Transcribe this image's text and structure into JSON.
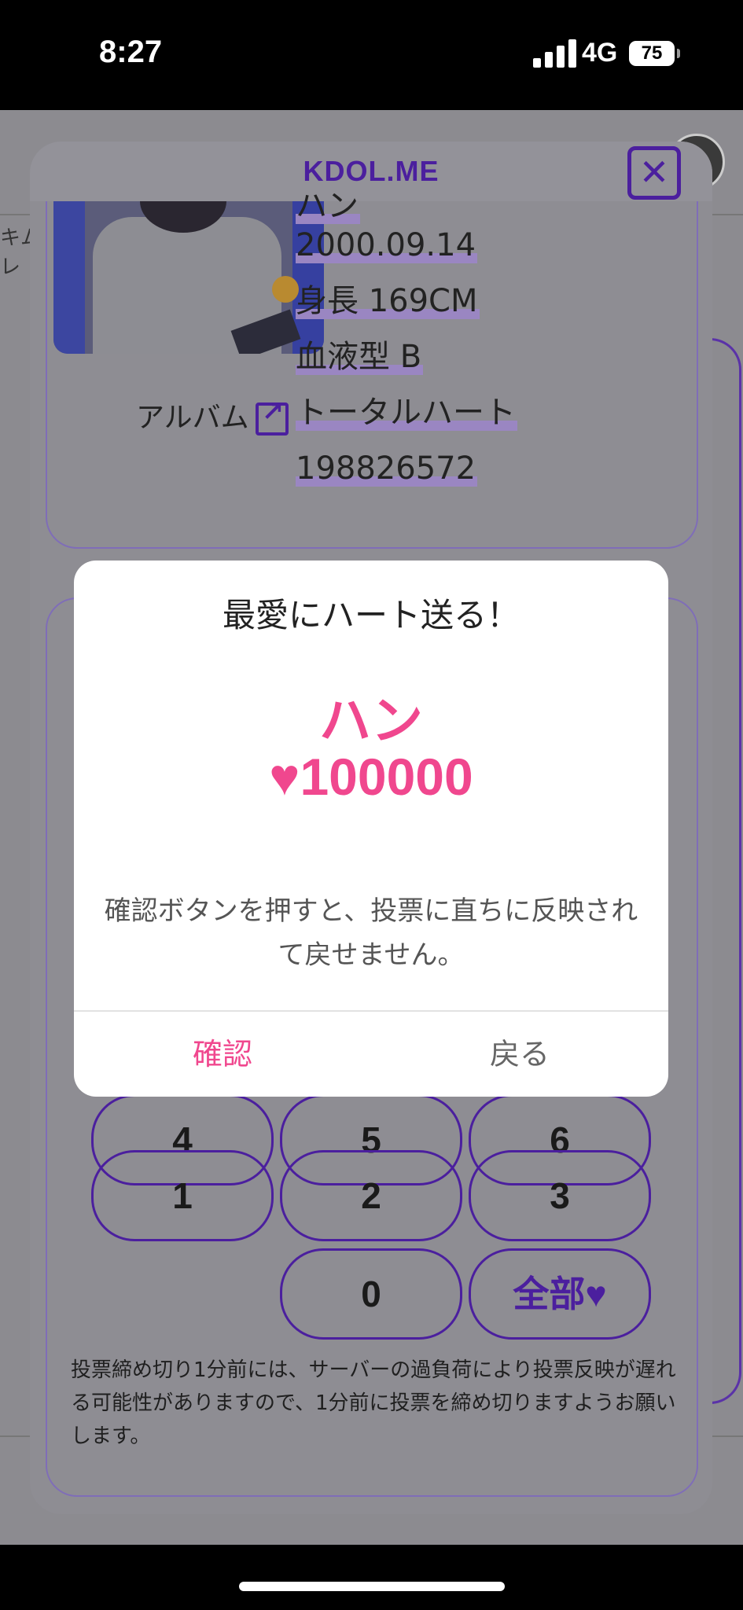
{
  "status_bar": {
    "time": "8:27",
    "network": "4G",
    "battery": "75"
  },
  "header": {
    "brand": "KDOL.ME"
  },
  "background": {
    "side_text": "キム\nレ"
  },
  "profile": {
    "name": "ハン",
    "birthday": "2000.09.14",
    "height": "身長 169CM",
    "blood_type": "血液型 B",
    "total_heart_label": "トータルハート",
    "total_heart_value": "198826572",
    "album_label": "アルバム"
  },
  "keypad": {
    "keys": [
      "4",
      "5",
      "6",
      "1",
      "2",
      "3",
      "0",
      "全部♥"
    ]
  },
  "note": "投票締め切り1分前には、サーバーの過負荷により投票反映が遅れる可能性がありますので、1分前に投票を締め切りますようお願いします。",
  "dialog": {
    "title": "最愛にハート送る！",
    "name": "ハン",
    "amount": "♥100000",
    "message": "確認ボタンを押すと、投票に直ちに反映されて戻せません。",
    "confirm_label": "確認",
    "back_label": "戻る"
  },
  "colors": {
    "accent": "#4b1f9e",
    "pink": "#f0478e"
  }
}
